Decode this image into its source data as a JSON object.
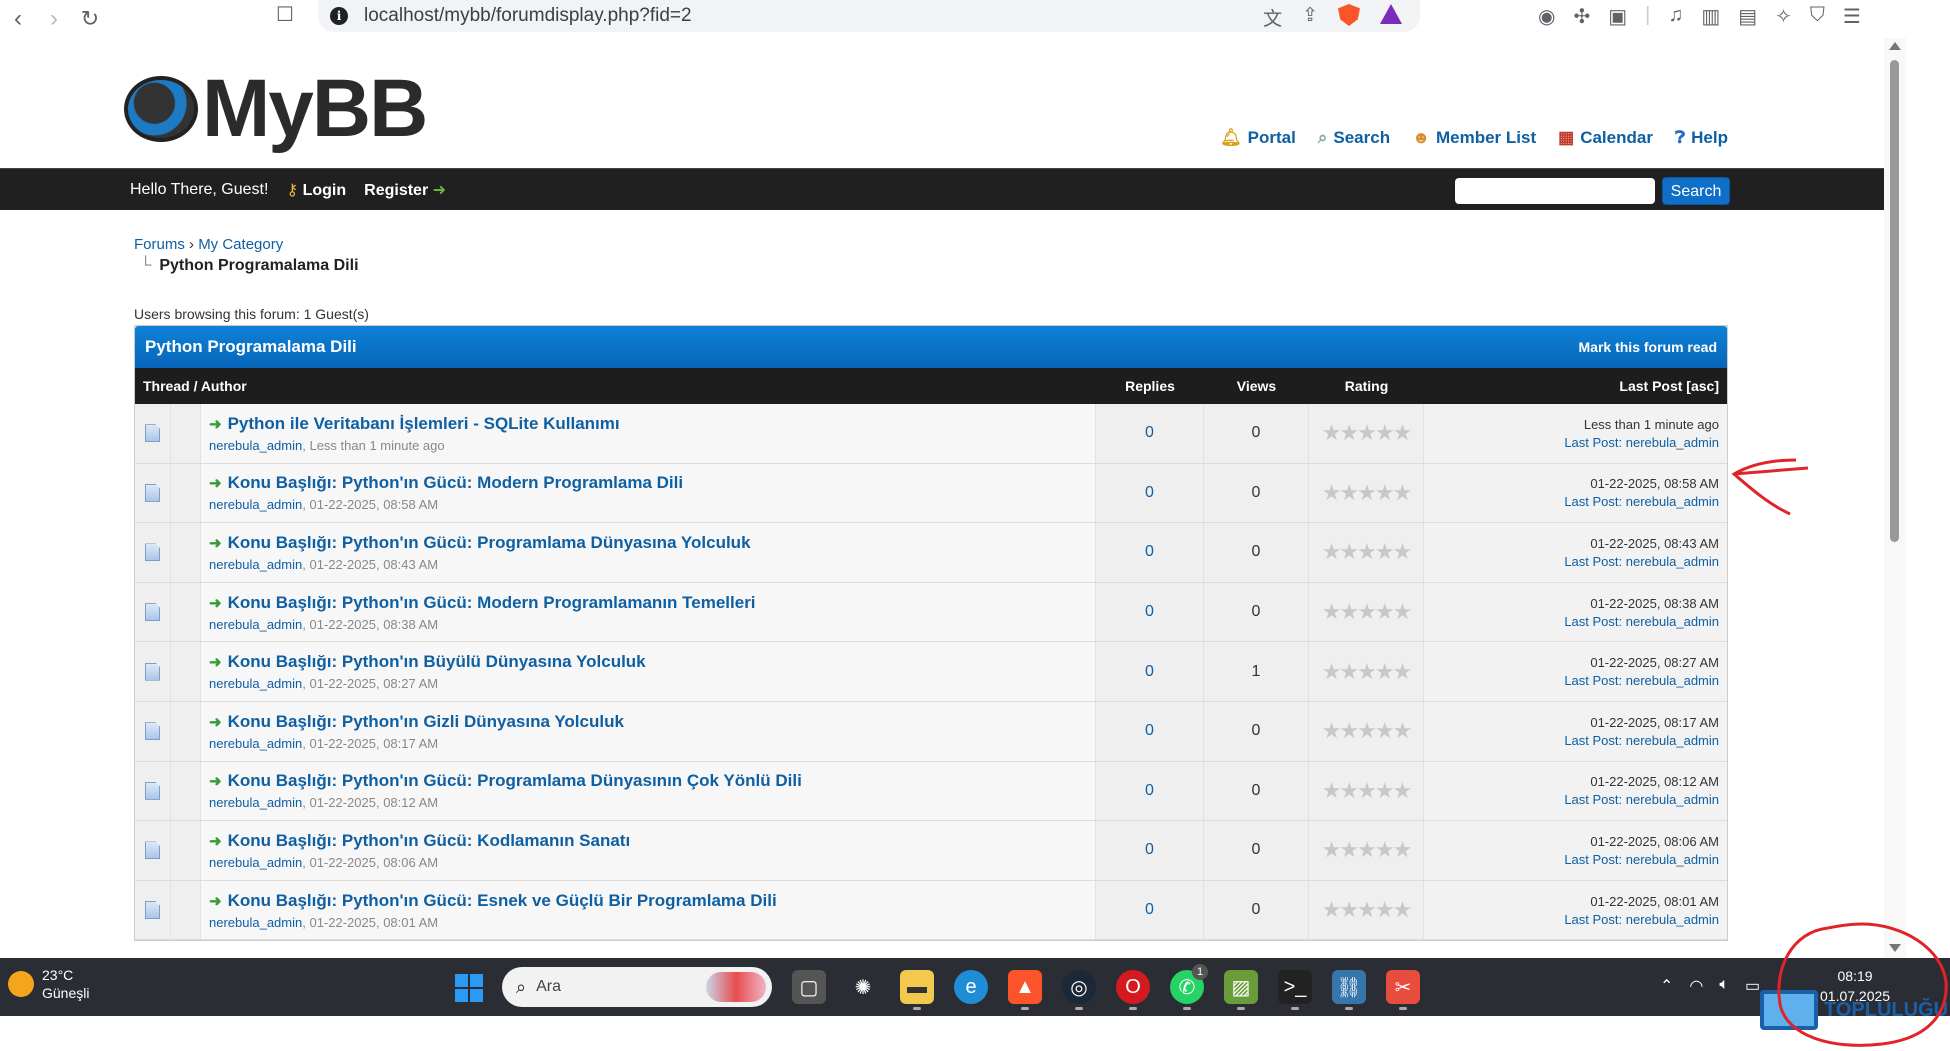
{
  "browser": {
    "url": "localhost/mybb/forumdisplay.php?fid=2"
  },
  "header": {
    "logo_text": "MyBB",
    "links": [
      {
        "label": "Portal",
        "icon": "bell-icon"
      },
      {
        "label": "Search",
        "icon": "magnifier-icon"
      },
      {
        "label": "Member List",
        "icon": "users-icon"
      },
      {
        "label": "Calendar",
        "icon": "calendar-icon"
      },
      {
        "label": "Help",
        "icon": "help-icon"
      }
    ]
  },
  "panel": {
    "welcome": "Hello There, Guest!",
    "login": "Login",
    "register": "Register",
    "search_button": "Search"
  },
  "breadcrumb": {
    "forums": "Forums",
    "separator": "›",
    "category": "My Category",
    "current": "Python Programalama Dili"
  },
  "browsing": "Users browsing this forum: 1 Guest(s)",
  "forum": {
    "title": "Python Programalama Dili",
    "mark_read": "Mark this forum read",
    "columns": {
      "thread": "Thread / Author",
      "replies": "Replies",
      "views": "Views",
      "rating": "Rating",
      "last_post": "Last Post [asc]"
    },
    "threads": [
      {
        "title": "Python ile Veritabanı İşlemleri - SQLite Kullanımı",
        "author": "nerebula_admin",
        "date": "Less than 1 minute ago",
        "replies": "0",
        "views": "0",
        "last_date": "Less than 1 minute ago",
        "last_author": "nerebula_admin"
      },
      {
        "title": "Konu Başlığı: Python'ın Gücü: Modern Programlama Dili",
        "author": "nerebula_admin",
        "date": "01-22-2025, 08:58 AM",
        "replies": "0",
        "views": "0",
        "last_date": "01-22-2025, 08:58 AM",
        "last_author": "nerebula_admin"
      },
      {
        "title": "Konu Başlığı: Python'ın Gücü: Programlama Dünyasına Yolculuk",
        "author": "nerebula_admin",
        "date": "01-22-2025, 08:43 AM",
        "replies": "0",
        "views": "0",
        "last_date": "01-22-2025, 08:43 AM",
        "last_author": "nerebula_admin"
      },
      {
        "title": "Konu Başlığı: Python'ın Gücü: Modern Programlamanın Temelleri",
        "author": "nerebula_admin",
        "date": "01-22-2025, 08:38 AM",
        "replies": "0",
        "views": "0",
        "last_date": "01-22-2025, 08:38 AM",
        "last_author": "nerebula_admin"
      },
      {
        "title": "Konu Başlığı: Python'ın Büyülü Dünyasına Yolculuk",
        "author": "nerebula_admin",
        "date": "01-22-2025, 08:27 AM",
        "replies": "0",
        "views": "1",
        "last_date": "01-22-2025, 08:27 AM",
        "last_author": "nerebula_admin"
      },
      {
        "title": "Konu Başlığı: Python'ın Gizli Dünyasına Yolculuk",
        "author": "nerebula_admin",
        "date": "01-22-2025, 08:17 AM",
        "replies": "0",
        "views": "0",
        "last_date": "01-22-2025, 08:17 AM",
        "last_author": "nerebula_admin"
      },
      {
        "title": "Konu Başlığı: Python'ın Gücü: Programlama Dünyasının Çok Yönlü Dili",
        "author": "nerebula_admin",
        "date": "01-22-2025, 08:12 AM",
        "replies": "0",
        "views": "0",
        "last_date": "01-22-2025, 08:12 AM",
        "last_author": "nerebula_admin"
      },
      {
        "title": "Konu Başlığı: Python'ın Gücü: Kodlamanın Sanatı",
        "author": "nerebula_admin",
        "date": "01-22-2025, 08:06 AM",
        "replies": "0",
        "views": "0",
        "last_date": "01-22-2025, 08:06 AM",
        "last_author": "nerebula_admin"
      },
      {
        "title": "Konu Başlığı: Python'ın Gücü: Esnek ve Güçlü Bir Programlama Dili",
        "author": "nerebula_admin",
        "date": "01-22-2025, 08:01 AM",
        "replies": "0",
        "views": "0",
        "last_date": "01-22-2025, 08:01 AM",
        "last_author": "nerebula_admin"
      }
    ],
    "last_post_label": "Last Post"
  },
  "taskbar": {
    "temperature": "23°C",
    "weather": "Güneşli",
    "search_placeholder": "Ara",
    "time": "08:19",
    "date": "01.07.2025",
    "whatsapp_badge": "1"
  },
  "watermark": {
    "line2": "TOPLULUĞU"
  }
}
